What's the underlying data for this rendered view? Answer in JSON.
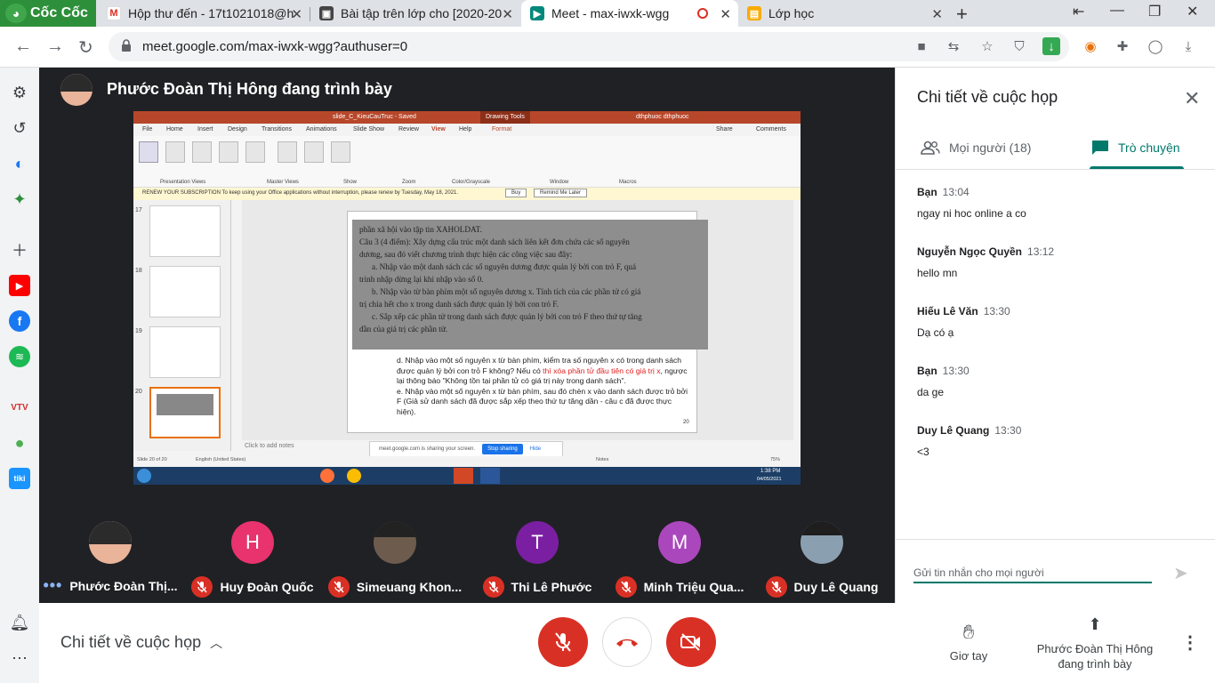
{
  "browser": {
    "brand": "Cốc Cốc",
    "tabs": [
      {
        "title": "Hộp thư đến - 17t1021018@h",
        "icon": "gmail-icon"
      },
      {
        "title": "Bài tập trên lớp cho [2020-20",
        "icon": "classroom-icon"
      },
      {
        "title": "Meet - max-iwxk-wgg",
        "icon": "meet-icon",
        "active": true
      },
      {
        "title": "Lớp học",
        "icon": "classroom-icon"
      }
    ],
    "url": "meet.google.com/max-iwxk-wgg?authuser=0"
  },
  "presenter": {
    "title": "Phước Đoàn Thị Hông đang trình bày"
  },
  "shared_screen": {
    "ppt_filename": "slide_C_KieuCauTruc - Saved",
    "ppt_tool": "Drawing Tools",
    "ppt_user": "dthphuoc dthphuoc",
    "ppt_menu": [
      "File",
      "Home",
      "Insert",
      "Design",
      "Transitions",
      "Animations",
      "Slide Show",
      "Review",
      "View",
      "Help",
      "Format"
    ],
    "ppt_share": "Share",
    "ppt_comments": "Comments",
    "ppt_warning": "RENEW YOUR SUBSCRIPTION  To keep using your Office applications without interruption, please renew by Tuesday, May 18, 2021.",
    "ppt_buy": "Buy",
    "ppt_remind": "Remind Me Later",
    "ribbon_groups": [
      "Presentation Views",
      "Master Views",
      "Show",
      "Zoom",
      "Color/Grayscale",
      "Window",
      "Macros"
    ],
    "thumb_numbers": [
      "17",
      "18",
      "19",
      "20"
    ],
    "photo_lines": [
      "phần xã hội vào tập tin XAHOLDAT.",
      "Câu 3 (4 điểm): Xây dựng cấu trúc một danh sách liên kết đơn chứa các số nguyên",
      "dương, sau đó viết chương trình thực hiện các công việc sau đây:",
      "a. Nhập vào một danh sách các số nguyên dương được quản lý bởi con trỏ F, quá",
      "trình nhập dừng lại khi nhập vào số 0.",
      "b. Nhập vào từ bàn phím một số nguyên dương x. Tính tích của các phần tử có giá",
      "trị chia hết cho x trong danh sách được quản lý bởi con trỏ F.",
      "c. Sắp xếp các phần tử trong danh sách được quản lý bởi con trỏ F theo thứ tự tăng",
      "dần của giá trị các phần tử."
    ],
    "slide_d_1": "d. Nhập vào một số nguyên x từ bàn phím, kiểm tra số nguyên x có trong danh sách được quản lý bởi con trỏ F không? Nếu có ",
    "slide_d_red": "thì xóa phần tử đầu tiên có giá trị x",
    "slide_d_2": ", ngược lại thông báo \"Không tồn tại phần tử có giá trị này trong danh sách\".",
    "slide_e": "e. Nhập vào một số nguyên x từ bàn phím, sau đó chèn x vào danh sách được trỏ bởi F (Giả sử danh sách đã được sắp xếp theo thứ tự tăng dần - câu c đã được thực hiện).",
    "slide_page": "20",
    "notes_placeholder": "Click to add notes",
    "status_left": "Slide 20 of 20",
    "status_lang": "English (United States)",
    "status_notes": "Notes",
    "zoom": "75%",
    "share_notice": "meet.google.com is sharing your screen.",
    "stop_sharing": "Stop sharing",
    "hide": "Hide",
    "clock_time": "1:38 PM",
    "clock_date": "04/05/2021"
  },
  "participants": [
    {
      "name": "Phước Đoàn Thị...",
      "initial": "",
      "color": "#e9b49a",
      "photo": true,
      "speaking": true
    },
    {
      "name": "Huy Đoàn Quốc",
      "initial": "H",
      "color": "#e8336e"
    },
    {
      "name": "Simeuang Khon...",
      "initial": "",
      "color": "#6d5b4e",
      "photo": true
    },
    {
      "name": "Thi Lê Phước",
      "initial": "T",
      "color": "#7b1fa2"
    },
    {
      "name": "Minh Triệu Qua...",
      "initial": "M",
      "color": "#ab47bc"
    },
    {
      "name": "Duy Lê Quang",
      "initial": "",
      "color": "#8aa0b0",
      "photo": true
    }
  ],
  "panel": {
    "title": "Chi tiết về cuộc họp",
    "tab_people": "Mọi người (18)",
    "tab_chat": "Trò chuyện",
    "messages": [
      {
        "sender": "Bạn",
        "time": "13:04",
        "text": "ngay ni hoc online a co"
      },
      {
        "sender": "Nguyễn Ngọc Quyền",
        "time": "13:12",
        "text": "hello mn"
      },
      {
        "sender": "Hiếu Lê Văn",
        "time": "13:30",
        "text": "Dạ có ạ"
      },
      {
        "sender": "Bạn",
        "time": "13:30",
        "text": "da ge"
      },
      {
        "sender": "Duy Lê Quang",
        "time": "13:30",
        "text": "<3"
      }
    ],
    "input_placeholder": "Gửi tin nhắn cho mọi người"
  },
  "bottom": {
    "meeting_details": "Chi tiết về cuộc họp",
    "raise_hand": "Giơ tay",
    "presenting_line1": "Phước Đoàn Thị Hông",
    "presenting_line2": "đang trình bày"
  },
  "colors": {
    "accent": "#00796b",
    "danger": "#d93025",
    "stage": "#202124"
  }
}
